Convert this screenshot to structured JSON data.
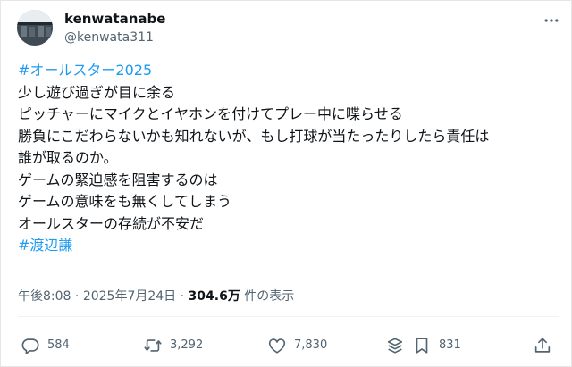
{
  "user": {
    "display_name": "kenwatanabe",
    "handle": "@kenwata311"
  },
  "tweet": {
    "lines": [
      {
        "text": "#オールスター2025",
        "hashtag": true
      },
      {
        "text": "少し遊び過ぎが目に余る",
        "hashtag": false
      },
      {
        "text": "ピッチャーにマイクとイヤホンを付けてプレー中に喋らせる",
        "hashtag": false
      },
      {
        "text": "勝負にこだわらないかも知れないが、もし打球が当たったりしたら責任は",
        "hashtag": false
      },
      {
        "text": "誰が取るのか。",
        "hashtag": false
      },
      {
        "text": "ゲームの緊迫感を阻害するのは",
        "hashtag": false
      },
      {
        "text": "ゲームの意味をも無くしてしまう",
        "hashtag": false
      },
      {
        "text": "オールスターの存続が不安だ",
        "hashtag": false
      },
      {
        "text": "#渡辺謙",
        "hashtag": true
      }
    ]
  },
  "meta": {
    "time": "午後8:08",
    "separator": "·",
    "date": "2025年7月24日",
    "views_count": "304.6万",
    "views_label": "件の表示"
  },
  "actions": {
    "replies": "584",
    "reposts": "3,292",
    "likes": "7,830",
    "bookmarks": "831"
  },
  "colors": {
    "hashtag": "#1d9bf0",
    "secondary_text": "#536471",
    "primary_text": "#0f1419"
  },
  "icons": [
    "more-icon",
    "reply-icon",
    "repost-icon",
    "like-icon",
    "grok-icon",
    "bookmark-icon",
    "share-icon"
  ]
}
